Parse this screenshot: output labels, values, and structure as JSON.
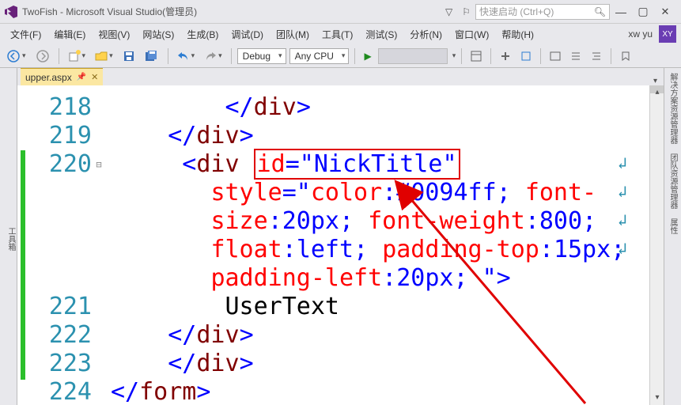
{
  "title": "TwoFish - Microsoft Visual Studio(管理员)",
  "quick_launch_placeholder": "快速启动 (Ctrl+Q)",
  "menus": {
    "file": "文件(F)",
    "edit": "编辑(E)",
    "view": "视图(V)",
    "website": "网站(S)",
    "build": "生成(B)",
    "debug": "调试(D)",
    "team": "团队(M)",
    "tools": "工具(T)",
    "test": "测试(S)",
    "analyze": "分析(N)",
    "window": "窗口(W)",
    "help": "帮助(H)"
  },
  "user": {
    "name": "xw yu",
    "initials": "XY"
  },
  "toolbar": {
    "config": "Debug",
    "platform": "Any CPU"
  },
  "left_panel": "工具箱",
  "right_panels": {
    "p1": "解决方案资源管理器",
    "p2": "团队资源管理器",
    "p3": "属性"
  },
  "tab": {
    "filename": "upper.aspx"
  },
  "lines": {
    "l218": "218",
    "l219": "219",
    "l220": "220",
    "l221": "221",
    "l222": "222",
    "l223": "223",
    "l224": "224"
  },
  "code": {
    "c218_close_div": "</div>",
    "c219_close_div": "</div>",
    "c220_open": "<div ",
    "c220_id_attr": "id=\"NickTitle\"",
    "c220_cont1": "style=\"color:#0094ff; font-",
    "c220_cont2": "size:20px; font-weight:800;",
    "c220_cont3": "float:left; padding-top:15px;",
    "c220_cont4": "padding-left:20px; \">",
    "c221_text": "UserText",
    "c222_close_div": "</div>",
    "c223_close_div": "</div>",
    "c224_close_form": "</form>",
    "style_label": "style",
    "color_label": "color",
    "color_value": "#0094ff",
    "font_label": "font-",
    "size_label": "size",
    "size_val": "20px",
    "fw_label": "font-weight",
    "fw_val": "800",
    "float_label": "float",
    "float_val": "left",
    "pt_label": "padding-top",
    "pt_val": "15px",
    "pl_label": "padding-left",
    "pl_val": "20px",
    "id_label": "id",
    "id_val": "NickTitle",
    "div_tag": "div",
    "form_tag": "form"
  }
}
